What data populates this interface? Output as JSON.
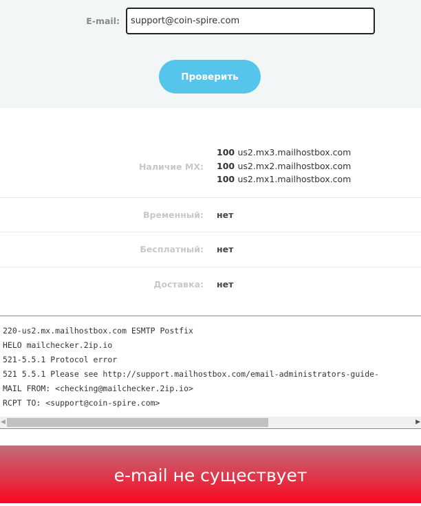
{
  "form": {
    "email_label": "E-mail:",
    "email_value": "support@coin-spire.com",
    "check_button": "Проверить"
  },
  "results": {
    "mx_label": "Наличие MX:",
    "mx": [
      {
        "priority": "100",
        "host": "us2.mx3.mailhostbox.com"
      },
      {
        "priority": "100",
        "host": "us2.mx2.mailhostbox.com"
      },
      {
        "priority": "100",
        "host": "us2.mx1.mailhostbox.com"
      }
    ],
    "temporary_label": "Временный:",
    "temporary_value": "нет",
    "free_label": "Бесплатный:",
    "free_value": "нет",
    "delivery_label": "Доставка:",
    "delivery_value": "нет"
  },
  "log": [
    "220-us2.mx.mailhostbox.com ESMTP Postfix",
    "HELO mailchecker.2ip.io",
    "521-5.5.1 Protocol error",
    "521 5.5.1 Please see http://support.mailhostbox.com/email-administrators-guide-",
    "MAIL FROM: <checking@mailchecker.2ip.io>",
    "RCPT TO: <support@coin-spire.com>"
  ],
  "status": {
    "text": "e-mail не существует",
    "color": "#f8081e"
  }
}
